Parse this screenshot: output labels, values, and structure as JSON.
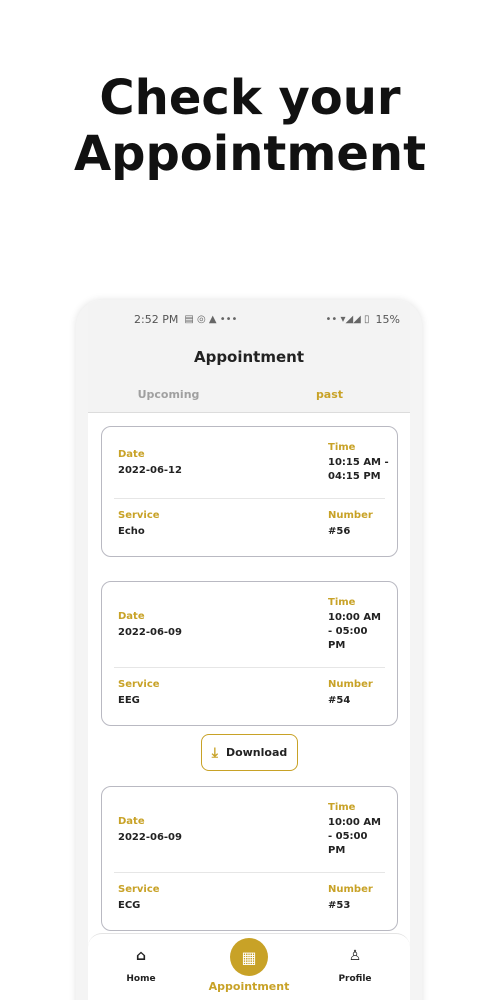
{
  "headline": {
    "line1": "Check your",
    "line2": "Appointment"
  },
  "status_bar": {
    "time": "2:52 PM",
    "left_icons": "▤ ◎ ▲ •••",
    "right_icons": "•• ▾◢◢ ▯",
    "battery": "15%"
  },
  "header": {
    "title": "Appointment"
  },
  "tabs": [
    {
      "label": "Upcoming"
    },
    {
      "label": "past"
    }
  ],
  "appointments": [
    {
      "date_label": "Date",
      "date": "2022-06-12",
      "time_label": "Time",
      "time": "10:15 AM - 04:15 PM",
      "service_label": "Service",
      "service": "Echo",
      "number_label": "Number",
      "number": "#56"
    },
    {
      "date_label": "Date",
      "date": "2022-06-09",
      "time_label": "Time",
      "time": "10:00 AM - 05:00 PM",
      "service_label": "Service",
      "service": "EEG",
      "number_label": "Number",
      "number": "#54"
    },
    {
      "date_label": "Date",
      "date": "2022-06-09",
      "time_label": "Time",
      "time": "10:00 AM - 05:00 PM",
      "service_label": "Service",
      "service": "ECG",
      "number_label": "Number",
      "number": "#53"
    }
  ],
  "download": {
    "label": "Download"
  },
  "bottom_nav": [
    {
      "label": "Home"
    },
    {
      "label": "Appointment"
    },
    {
      "label": "Profile"
    }
  ],
  "colors": {
    "accent": "#c8a227",
    "card_border": "#b9b9c2"
  }
}
